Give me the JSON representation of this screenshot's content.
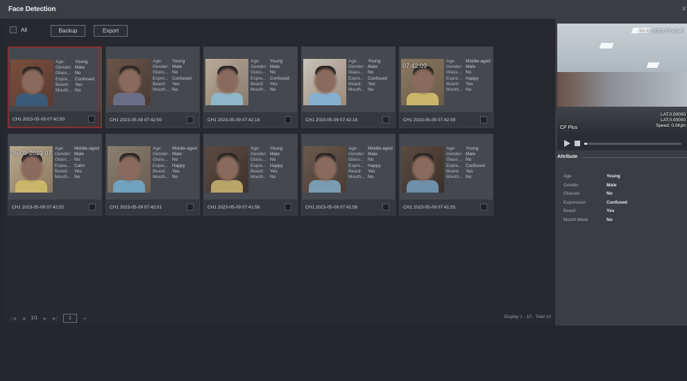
{
  "window": {
    "title": "Face Detection",
    "close_label": "x"
  },
  "toolbar": {
    "all_label": "All",
    "backup_label": "Backup",
    "export_label": "Export"
  },
  "attr_keys": [
    "Age:",
    "Gender:",
    "Glass...",
    "Expre...",
    "Beard:",
    "Mouth..."
  ],
  "cards": [
    {
      "age": "Young",
      "gender": "Male",
      "glasses": "No",
      "expression": "Confused",
      "beard": "Yes",
      "mouth": "No",
      "time": "CH1 2023-05-09 07:42:50",
      "selected": true,
      "stamp": ""
    },
    {
      "age": "Young",
      "gender": "Male",
      "glasses": "No",
      "expression": "Confused",
      "beard": "Yes",
      "mouth": "No",
      "time": "CH1 2023-05-09 07:42:50",
      "selected": false,
      "stamp": ""
    },
    {
      "age": "Young",
      "gender": "Male",
      "glasses": "No",
      "expression": "Confused",
      "beard": "Yes",
      "mouth": "No",
      "time": "CH1 2023-05-09 07:42:18",
      "selected": false,
      "stamp": ""
    },
    {
      "age": "Young",
      "gender": "Male",
      "glasses": "No",
      "expression": "Confused",
      "beard": "Yes",
      "mouth": "No",
      "time": "CH1 2023-05-09 07:42:18",
      "selected": false,
      "stamp": ""
    },
    {
      "age": "Middle-aged",
      "gender": "Male",
      "glasses": "No",
      "expression": "Happy",
      "beard": "Yes",
      "mouth": "No",
      "time": "CH1 2023-05-09 07:42:09",
      "selected": false,
      "stamp": "07:42:09"
    },
    {
      "age": "Middle-aged",
      "gender": "Male",
      "glasses": "No",
      "expression": "Calm",
      "beard": "Yes",
      "mouth": "No",
      "time": "CH1 2023-05-09 07:42:02",
      "selected": false,
      "stamp": "05-09-2023 07:4"
    },
    {
      "age": "Middle-aged",
      "gender": "Male",
      "glasses": "No",
      "expression": "Happy",
      "beard": "Yes",
      "mouth": "No",
      "time": "CH1 2023-05-09 07:42:01",
      "selected": false,
      "stamp": ""
    },
    {
      "age": "Young",
      "gender": "Male",
      "glasses": "No",
      "expression": "Happy",
      "beard": "Yes",
      "mouth": "No",
      "time": "CH1 2023-05-09 07:41:58",
      "selected": false,
      "stamp": ""
    },
    {
      "age": "Middle-aged",
      "gender": "Male",
      "glasses": "No",
      "expression": "Happy",
      "beard": "Yes",
      "mouth": "No",
      "time": "CH1 2023-05-09 07:41:58",
      "selected": false,
      "stamp": ""
    },
    {
      "age": "Young",
      "gender": "Male",
      "glasses": "No",
      "expression": "Confused",
      "beard": "Yes",
      "mouth": "No",
      "time": "CH1 2023-05-09 07:41:55",
      "selected": false,
      "stamp": ""
    }
  ],
  "pager": {
    "page_info": "1/1",
    "page_input": "1"
  },
  "display_info": "Display 1 - 10 , Total 10",
  "preview": {
    "timestamp": "05-09-2023 07:42:47",
    "camera_name": "CP Plus",
    "gps_lines": [
      "LAT:0.00000",
      "LAT:0.00000",
      "Speed: 0.0Kph"
    ]
  },
  "attribute_panel": {
    "heading": "Attribute",
    "rows": [
      {
        "key": "Age",
        "value": "Young"
      },
      {
        "key": "Gender",
        "value": "Male"
      },
      {
        "key": "Glasses",
        "value": "No"
      },
      {
        "key": "Expression",
        "value": "Confused"
      },
      {
        "key": "Beard",
        "value": "Yes"
      },
      {
        "key": "Mouth Mask",
        "value": "No"
      }
    ]
  },
  "colors": {
    "selected_border": "#8a2f33",
    "panel_bg": "#3a3d42",
    "card_bg": "#45484f"
  },
  "icons": {
    "play": "play-icon",
    "stop": "stop-icon",
    "close": "close-icon"
  }
}
